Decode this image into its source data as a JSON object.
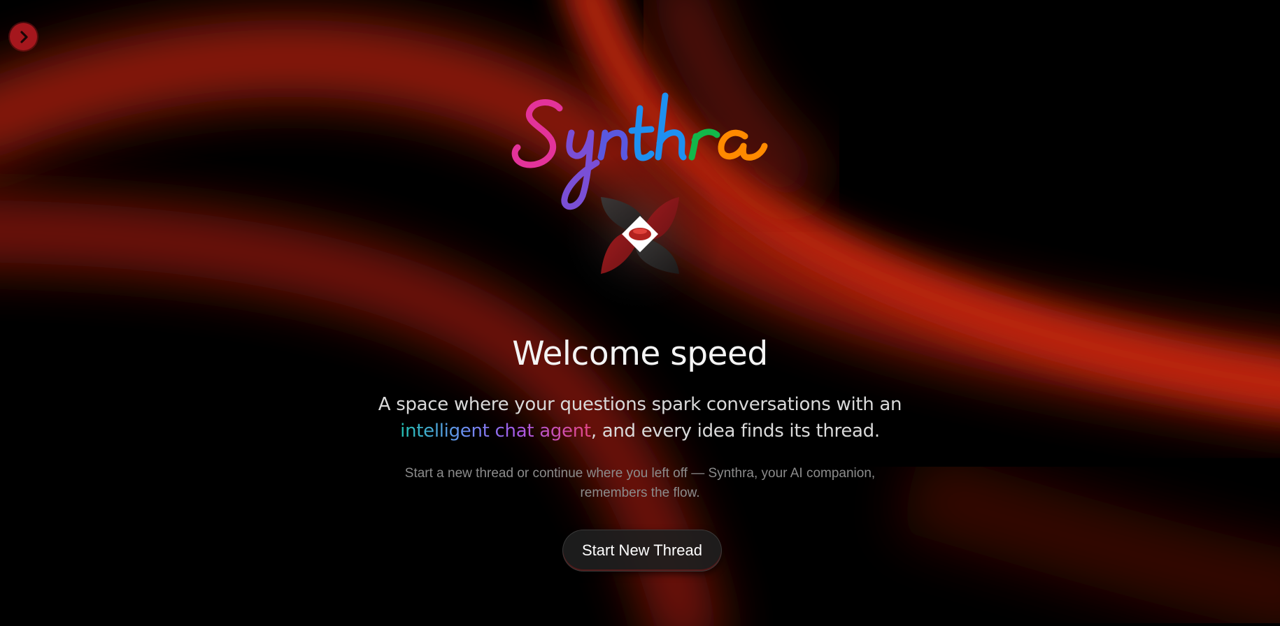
{
  "app": {
    "brand_name": "Synthra",
    "brand_colors": [
      "#e3339a",
      "#7a4fd6",
      "#1e90f0",
      "#12b84a",
      "#ff8a00"
    ],
    "accent_color": "#a5171d"
  },
  "nav": {
    "toggle_icon": "chevron-right-icon"
  },
  "hero": {
    "welcome": "Welcome speed",
    "tagline_before": "A space where your questions spark conversations with an ",
    "tagline_highlight": "intelligent chat agent",
    "tagline_after": ", and every idea finds its thread.",
    "subtext": "Start a new thread or continue where you left off — Synthra, your AI companion, remembers the flow.",
    "cta_label": "Start New Thread"
  }
}
